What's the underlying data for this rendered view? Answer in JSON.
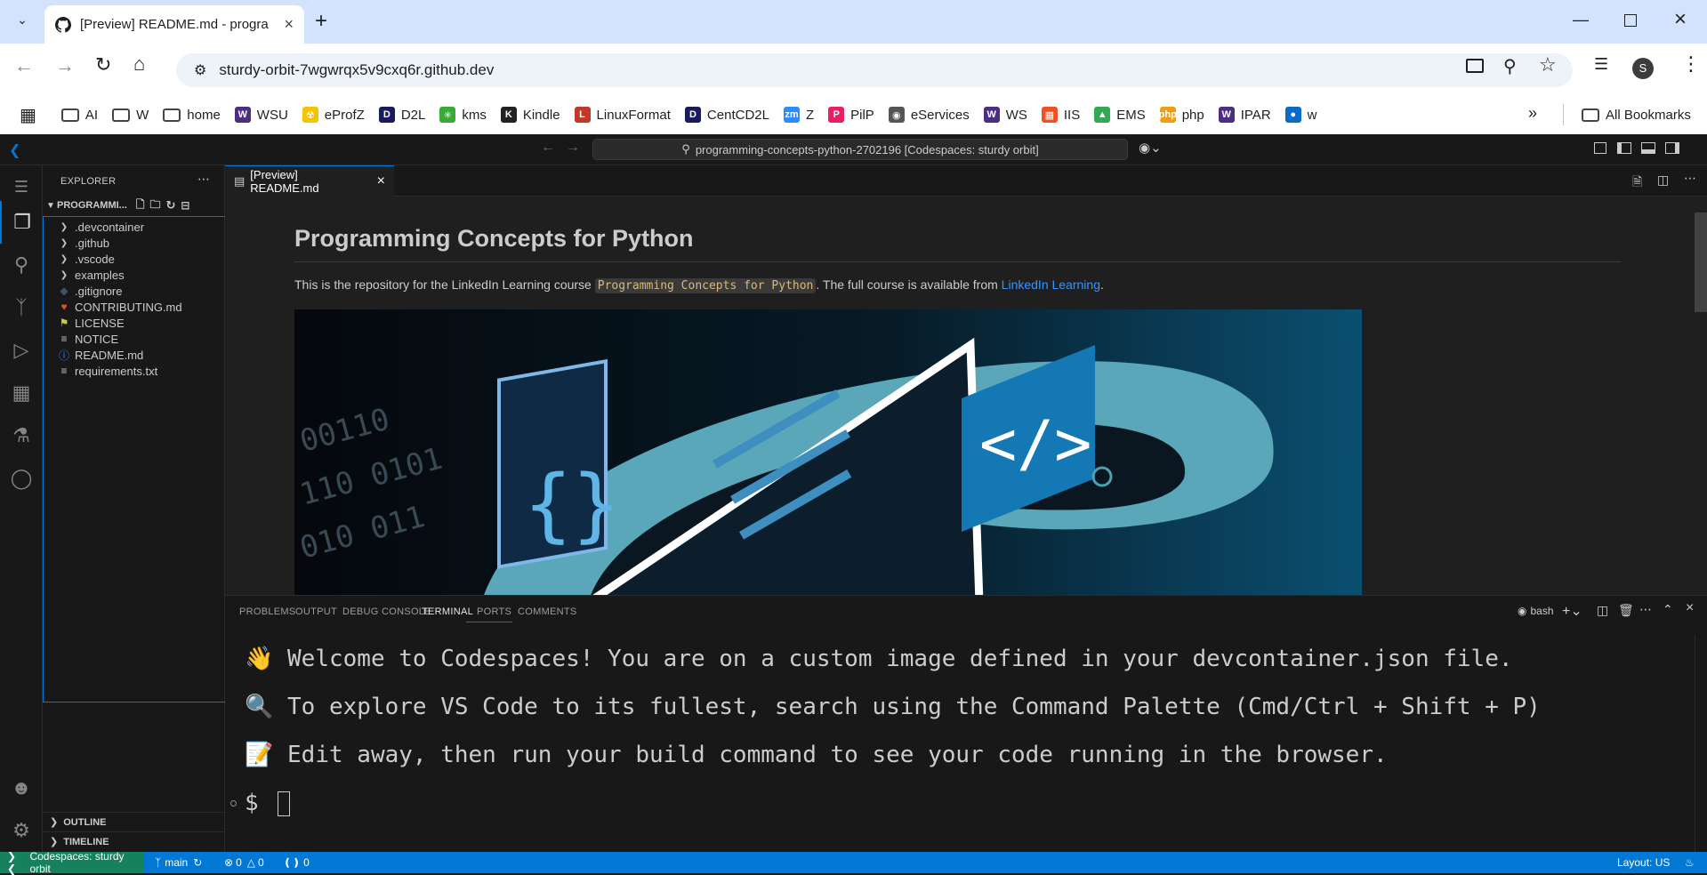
{
  "browser": {
    "tab_title": "[Preview] README.md - progra",
    "new_tab_symbol": "+",
    "url": "sturdy-orbit-7wgwrqx5v9cxq6r.github.dev",
    "profile_initial": "S",
    "bookmarks": [
      {
        "label": "AI",
        "icon": "folder-icon"
      },
      {
        "label": "W",
        "icon": "folder-icon"
      },
      {
        "label": "home",
        "icon": "folder-icon"
      },
      {
        "label": "WSU",
        "icon": "wsu-icon",
        "color": "#4b2e83"
      },
      {
        "label": "eProfZ",
        "icon": "radiation-icon",
        "color": "#f5c400"
      },
      {
        "label": "D2L",
        "icon": "d2l-icon",
        "color": "#1a1a5e"
      },
      {
        "label": "kms",
        "icon": "kms-icon",
        "color": "#3aaa35"
      },
      {
        "label": "Kindle",
        "icon": "kindle-icon",
        "color": "#222222"
      },
      {
        "label": "LinuxFormat",
        "icon": "linuxformat-icon",
        "color": "#c0392b"
      },
      {
        "label": "CentCD2L",
        "icon": "d2l-icon",
        "color": "#1a1a5e"
      },
      {
        "label": "Z",
        "icon": "zoom-icon",
        "color": "#2d8cff"
      },
      {
        "label": "PilP",
        "icon": "pilp-icon",
        "color": "#e91e63"
      },
      {
        "label": "eServices",
        "icon": "globe-icon",
        "color": "#555555"
      },
      {
        "label": "WS",
        "icon": "wsu-icon",
        "color": "#4b2e83"
      },
      {
        "label": "IIS",
        "icon": "windows-icon",
        "color": "#f25022"
      },
      {
        "label": "EMS",
        "icon": "ems-icon",
        "color": "#34a853"
      },
      {
        "label": "php",
        "icon": "php-icon",
        "color": "#f39c12"
      },
      {
        "label": "IPAR",
        "icon": "wsu-icon",
        "color": "#4b2e83"
      },
      {
        "label": "w",
        "icon": "w-icon",
        "color": "#0b6bcb"
      }
    ],
    "all_bookmarks": "All Bookmarks"
  },
  "vscode": {
    "command_center": "programming-concepts-python-2702196 [Codespaces: sturdy orbit]",
    "explorer_title": "EXPLORER",
    "project_name": "PROGRAMMI...",
    "files": [
      {
        "name": ".devcontainer",
        "type": "folder"
      },
      {
        "name": ".github",
        "type": "folder"
      },
      {
        "name": ".vscode",
        "type": "folder"
      },
      {
        "name": "examples",
        "type": "folder"
      },
      {
        "name": ".gitignore",
        "type": "gitignore"
      },
      {
        "name": "CONTRIBUTING.md",
        "type": "contributing"
      },
      {
        "name": "LICENSE",
        "type": "license"
      },
      {
        "name": "NOTICE",
        "type": "text"
      },
      {
        "name": "README.md",
        "type": "info"
      },
      {
        "name": "requirements.txt",
        "type": "text"
      }
    ],
    "outline_label": "OUTLINE",
    "timeline_label": "TIMELINE",
    "editor_tab": "[Preview] README.md",
    "readme": {
      "title": "Programming Concepts for Python",
      "text_before": "This is the repository for the LinkedIn Learning course ",
      "code": "Programming Concepts for Python",
      "text_middle": ". The full course is available from ",
      "link": "LinkedIn Learning",
      "text_after": "."
    },
    "panel_tabs": [
      "PROBLEMS",
      "OUTPUT",
      "DEBUG CONSOLE",
      "TERMINAL",
      "PORTS",
      "COMMENTS"
    ],
    "active_panel_tab": "TERMINAL",
    "terminal_name": "bash",
    "terminal_lines": [
      "👋 Welcome to Codespaces! You are on a custom image defined in your devcontainer.json file.",
      "🔍 To explore VS Code to its fullest, search using the Command Palette (Cmd/Ctrl + Shift + P)",
      "📝 Edit away, then run your build command to see your code running in the browser."
    ],
    "prompt": "$",
    "status": {
      "remote": "Codespaces: sturdy orbit",
      "branch": "main",
      "errors": "0",
      "warnings": "0",
      "ports": "0",
      "layout": "Layout: US"
    },
    "colors": {
      "accent": "#0078d4",
      "status_remote": "#16825d"
    }
  }
}
